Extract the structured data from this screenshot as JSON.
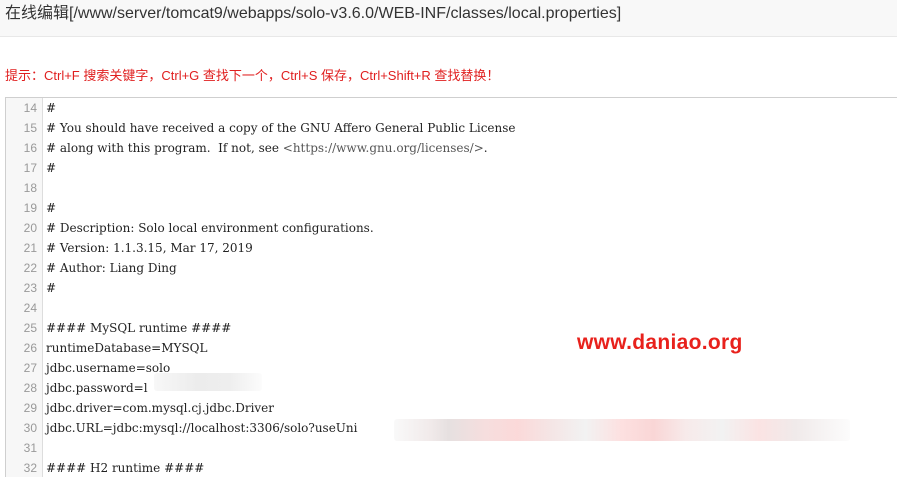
{
  "header": {
    "title": "在线编辑[/www/server/tomcat9/webapps/solo-v3.6.0/WEB-INF/classes/local.properties]"
  },
  "hint": "提示：Ctrl+F 搜索关键字，Ctrl+G 查找下一个，Ctrl+S 保存，Ctrl+Shift+R 查找替换！",
  "editor": {
    "lines": [
      {
        "num": "14",
        "code": "#"
      },
      {
        "num": "15",
        "code": "# You should have received a copy of the GNU Affero General Public License"
      },
      {
        "num": "16",
        "code": "# along with this program.  If not, see ",
        "url": "<https://www.gnu.org/licenses/>",
        "after": "."
      },
      {
        "num": "17",
        "code": "#"
      },
      {
        "num": "18",
        "code": ""
      },
      {
        "num": "19",
        "code": "#"
      },
      {
        "num": "20",
        "code": "# Description: Solo local environment configurations."
      },
      {
        "num": "21",
        "code": "# Version: 1.1.3.15, Mar 17, 2019"
      },
      {
        "num": "22",
        "code": "# Author: Liang Ding"
      },
      {
        "num": "23",
        "code": "#"
      },
      {
        "num": "24",
        "code": ""
      },
      {
        "num": "25",
        "code": "#### MySQL runtime ####"
      },
      {
        "num": "26",
        "code": "runtimeDatabase=MYSQL"
      },
      {
        "num": "27",
        "code": "jdbc.username=solo"
      },
      {
        "num": "28",
        "code": "jdbc.password=l"
      },
      {
        "num": "29",
        "code": "jdbc.driver=com.mysql.cj.jdbc.Driver"
      },
      {
        "num": "30",
        "code": "jdbc.URL=jdbc:mysql://localhost:3306/solo?useUni"
      },
      {
        "num": "31",
        "code": ""
      },
      {
        "num": "32",
        "code": "#### H2 runtime ####"
      }
    ]
  },
  "watermark": "www.daniao.org"
}
